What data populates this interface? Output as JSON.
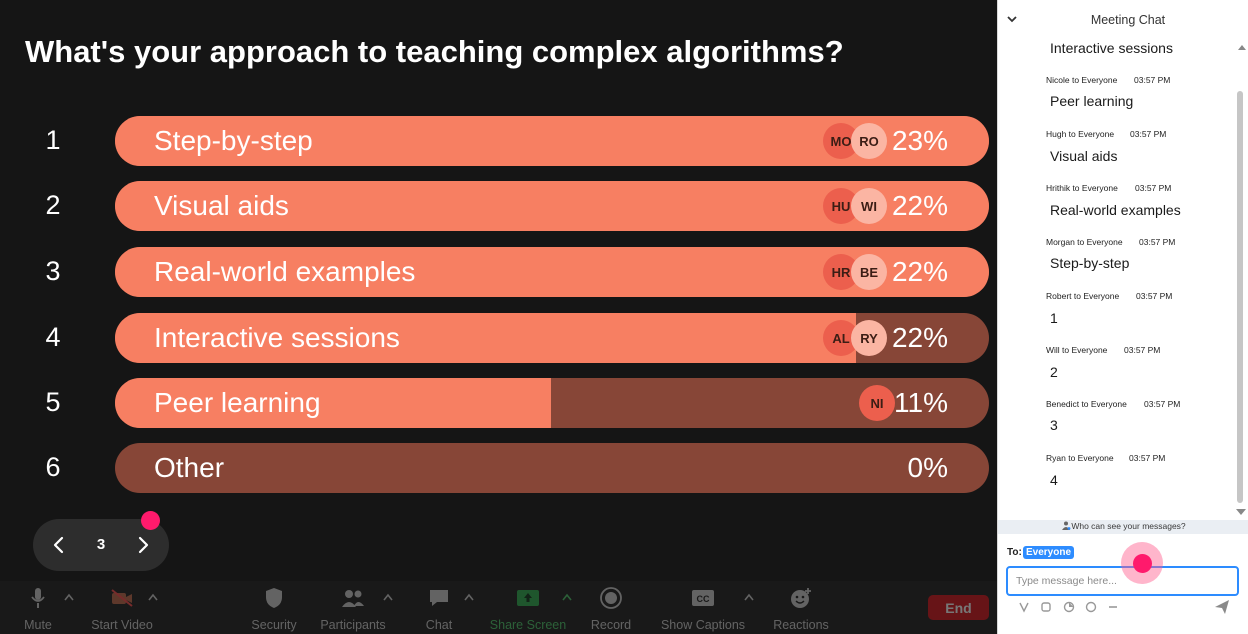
{
  "poll": {
    "title": "What's your approach to teaching complex algorithms?",
    "options": [
      {
        "num": "1",
        "label": "Step-by-step",
        "percent": "23%",
        "fill": 1.0,
        "avatars": [
          "MO",
          "RO"
        ]
      },
      {
        "num": "2",
        "label": "Visual aids",
        "percent": "22%",
        "fill": 1.0,
        "avatars": [
          "HU",
          "WI"
        ]
      },
      {
        "num": "3",
        "label": "Real-world examples",
        "percent": "22%",
        "fill": 1.0,
        "avatars": [
          "HR",
          "BE"
        ]
      },
      {
        "num": "4",
        "label": "Interactive sessions",
        "percent": "22%",
        "fill": 0.848,
        "avatars": [
          "AL",
          "RY"
        ]
      },
      {
        "num": "5",
        "label": "Peer learning",
        "percent": "11%",
        "fill": 0.499,
        "avatars": [
          "NI"
        ]
      },
      {
        "num": "6",
        "label": "Other",
        "percent": "0%",
        "fill": 0.0,
        "avatars": []
      }
    ],
    "colors": {
      "fill": "#f77f62",
      "track": "#874637"
    }
  },
  "page_nav": {
    "page": "3"
  },
  "toolbar": {
    "mute": "Mute",
    "start_video": "Start Video",
    "security": "Security",
    "participants": "Participants",
    "chat": "Chat",
    "share_screen": "Share Screen",
    "record": "Record",
    "show_captions": "Show Captions",
    "reactions": "Reactions",
    "end": "End"
  },
  "chat": {
    "title": "Meeting Chat",
    "messages": [
      {
        "sender": "",
        "time": "",
        "text": "Interactive sessions"
      },
      {
        "sender": "Nicole to Everyone",
        "time": "03:57 PM",
        "text": "Peer learning"
      },
      {
        "sender": "Hugh to Everyone",
        "time": "03:57 PM",
        "text": "Visual aids"
      },
      {
        "sender": "Hrithik to Everyone",
        "time": "03:57 PM",
        "text": "Real-world examples"
      },
      {
        "sender": "Morgan to Everyone",
        "time": "03:57 PM",
        "text": "Step-by-step"
      },
      {
        "sender": "Robert to Everyone",
        "time": "03:57 PM",
        "text": "1"
      },
      {
        "sender": "Will to Everyone",
        "time": "03:57 PM",
        "text": "2"
      },
      {
        "sender": "Benedict to Everyone",
        "time": "03:57 PM",
        "text": "3"
      },
      {
        "sender": "Ryan to Everyone",
        "time": "03:57 PM",
        "text": "4"
      }
    ],
    "who_can_see": "Who can see your messages?",
    "to_label": "To:",
    "to_value": "Everyone",
    "input_placeholder": "Type message here..."
  },
  "theme": {
    "accent": "#2d8cff",
    "end": "#d9141a",
    "cursor": "#ff1a6c"
  }
}
